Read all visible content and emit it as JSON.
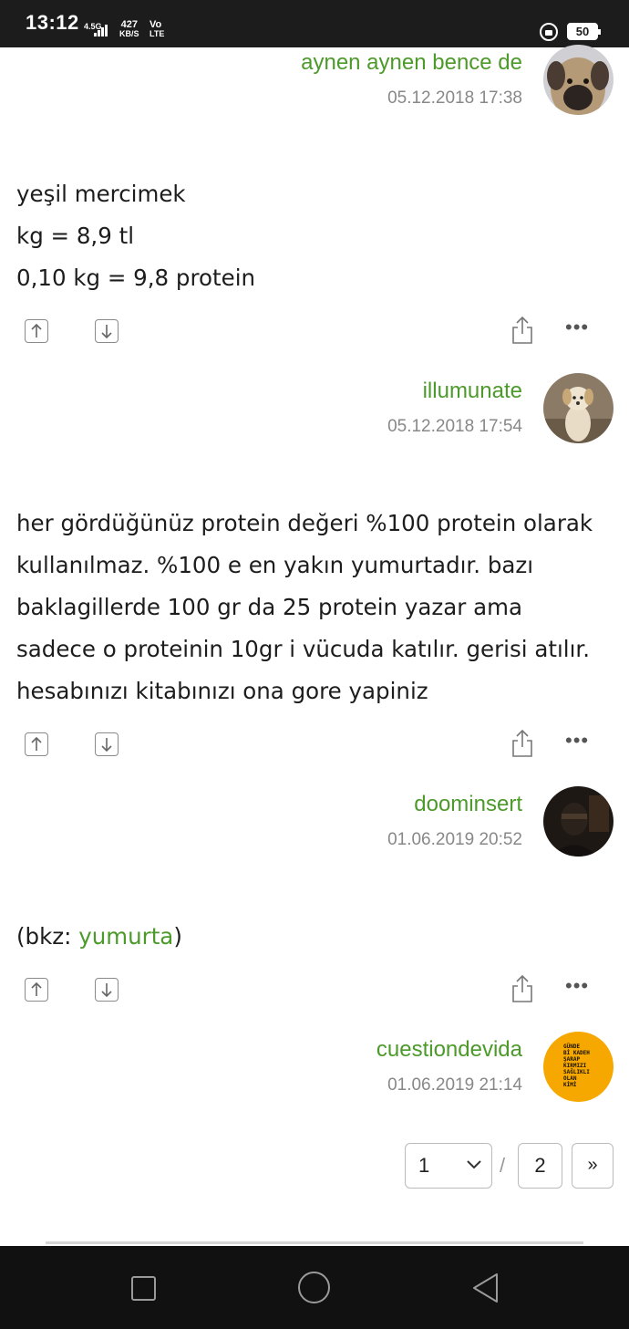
{
  "status_bar": {
    "time": "13:12",
    "network": "4.5G",
    "speed_value": "427",
    "speed_unit": "KB/S",
    "volte_top": "Vo",
    "volte_bottom": "LTE",
    "battery": "50"
  },
  "entries": [
    {
      "author": "aynen aynen bence de",
      "date": "05.12.2018 17:38",
      "avatar_icon": "mastiff-dog-avatar"
    },
    {
      "text_lines": [
        "yeşil mercimek",
        "kg = 8,9 tl",
        "0,10 kg = 9,8 protein"
      ],
      "author": "illumunate",
      "date": "05.12.2018 17:54",
      "avatar_icon": "puppy-avatar"
    },
    {
      "text_lines": [
        "her gördüğünüz protein değeri %100 protein olarak",
        "kullanılmaz. %100 e en yakın yumurtadır. bazı",
        "baklagillerde 100 gr da 25 protein yazar ama",
        "sadece o proteinin 10gr i vücuda katılır. gerisi atılır.",
        "hesabınızı kitabınızı ona gore yapiniz"
      ],
      "author": "doominsert",
      "date": "01.06.2019 20:52",
      "avatar_icon": "dark-portrait-avatar"
    },
    {
      "text_prefix": "(bkz: ",
      "text_link": "yumurta",
      "text_suffix": ")",
      "author": "cuestiondevida",
      "date": "01.06.2019 21:14",
      "avatar_icon": "yellow-text-avatar",
      "avatar_text": [
        "GÜNDE",
        "Bİ KADEH",
        "ŞARAP",
        "KIRMIZI",
        "SAĞLIKLI",
        "OLAN",
        "KİMİ"
      ]
    }
  ],
  "action_icons": [
    "upvote-icon",
    "downvote-icon",
    "share-icon",
    "more-icon"
  ],
  "pagination": {
    "current": "1",
    "separator": "/",
    "total": "2",
    "next": "»"
  },
  "colors": {
    "accent_green": "#4c9a2a",
    "date_gray": "#888888",
    "status_bar_bg": "#1c1c1c",
    "nav_bar_bg": "#111111"
  }
}
